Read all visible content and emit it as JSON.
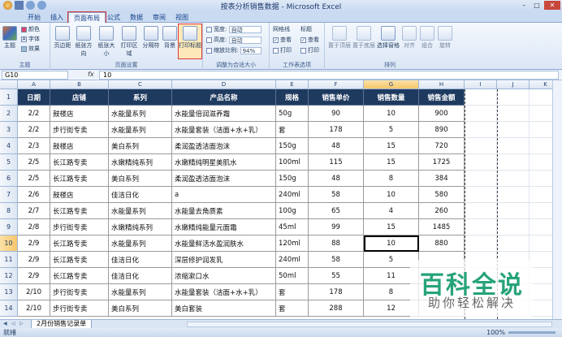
{
  "window": {
    "title": "按表分析销售数据 - Microsoft Excel"
  },
  "tabs": [
    "开始",
    "插入",
    "页面布局",
    "公式",
    "数据",
    "审阅",
    "视图"
  ],
  "ribbon": {
    "theme": {
      "theme": "主题",
      "colors": "颜色",
      "fonts": "字体",
      "effects": "效果",
      "group": "主题"
    },
    "page_setup": {
      "margins": "页边距",
      "orientation": "纸张方向",
      "size": "纸张大小",
      "print_area": "打印区域",
      "breaks": "分隔符",
      "background": "背景",
      "print_titles": "打印标题",
      "group": "页面设置"
    },
    "scale": {
      "width_label": "宽度:",
      "width_value": "自动",
      "height_label": "高度:",
      "height_value": "自动",
      "scale_label": "缩放比例:",
      "scale_value": "94%",
      "group": "调整为合适大小"
    },
    "sheet_options": {
      "gridlines": "网格线",
      "headings": "标题",
      "view": "查看",
      "print": "打印",
      "group": "工作表选项"
    },
    "arrange": {
      "bring_forward": "置于顶层",
      "send_backward": "置于底层",
      "selection_pane": "选择窗格",
      "align": "对齐",
      "group_btn": "组合",
      "rotate": "旋转",
      "group": "排列"
    }
  },
  "formula_bar": {
    "name_box": "G10",
    "fx": "fx",
    "value": "10"
  },
  "columns": [
    "A",
    "B",
    "C",
    "D",
    "E",
    "F",
    "G",
    "H",
    "I",
    "J",
    "K"
  ],
  "header_row": [
    "日期",
    "店铺",
    "系列",
    "产品名称",
    "规格",
    "销售单价",
    "销售数量",
    "销售金额"
  ],
  "rows": [
    [
      "2/2",
      "鼓楼店",
      "水能量系列",
      "水能量倍润滋养霜",
      "50g",
      "90",
      "10",
      "900"
    ],
    [
      "2/2",
      "步行街专卖",
      "水能量系列",
      "水能量套装（洁面+水+乳）",
      "套",
      "178",
      "5",
      "890"
    ],
    [
      "2/3",
      "鼓楼店",
      "美白系列",
      "柔润盈透洁面泡沫",
      "150g",
      "48",
      "15",
      "720"
    ],
    [
      "2/5",
      "长江路专卖",
      "水嫩精纯系列",
      "水嫩精纯明星美肌水",
      "100ml",
      "115",
      "15",
      "1725"
    ],
    [
      "2/5",
      "长江路专卖",
      "美白系列",
      "柔润盈透洁面泡沫",
      "150g",
      "48",
      "8",
      "384"
    ],
    [
      "2/6",
      "鼓楼店",
      "佳洁日化",
      "a",
      "240ml",
      "58",
      "10",
      "580"
    ],
    [
      "2/7",
      "长江路专卖",
      "水能量系列",
      "水能量去角质素",
      "100g",
      "65",
      "4",
      "260"
    ],
    [
      "2/8",
      "步行街专卖",
      "水嫩精纯系列",
      "水嫩精纯能量元面霜",
      "45ml",
      "99",
      "15",
      "1485"
    ],
    [
      "2/9",
      "长江路专卖",
      "水能量系列",
      "水能量鲜活水盈润肤水",
      "120ml",
      "88",
      "10",
      "880"
    ],
    [
      "2/9",
      "长江路专卖",
      "佳洁日化",
      "深层修护润发乳",
      "240ml",
      "58",
      "5",
      ""
    ],
    [
      "2/9",
      "长江路专卖",
      "佳洁日化",
      "浓缩漱口水",
      "50ml",
      "55",
      "11",
      ""
    ],
    [
      "2/10",
      "步行街专卖",
      "水能量系列",
      "水能量套装（洁面+水+乳）",
      "套",
      "178",
      "8",
      ""
    ],
    [
      "2/10",
      "步行街专卖",
      "美白系列",
      "美白套装",
      "套",
      "288",
      "12",
      ""
    ]
  ],
  "sheet_tab": "2月份销售记录单",
  "status": {
    "ready": "就绪",
    "zoom": "100%"
  },
  "watermark": {
    "main": "百科全说",
    "sub": "助你轻松解决"
  }
}
